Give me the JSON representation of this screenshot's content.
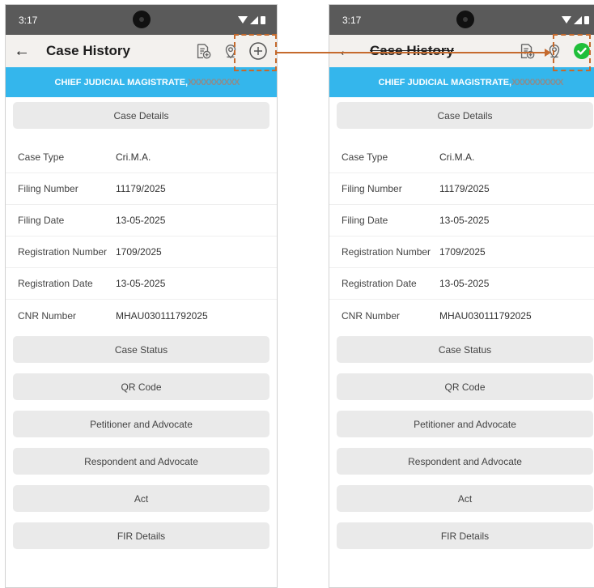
{
  "screens": [
    {
      "status": {
        "time": "3:17"
      },
      "header": {
        "back_icon": "arrow-left-icon",
        "title": "Case History",
        "action_icon": "add-circle-icon"
      },
      "court": {
        "name": "CHIEF JUDICIAL MAGISTRATE,",
        "redacted": "XXXXXXXXXX"
      },
      "case_details_label": "Case Details",
      "details": [
        {
          "label": "Case Type",
          "value": "Cri.M.A."
        },
        {
          "label": "Filing Number",
          "value": "11179/2025"
        },
        {
          "label": "Filing Date",
          "value": "13-05-2025"
        },
        {
          "label": "Registration Number",
          "value": "1709/2025"
        },
        {
          "label": "Registration Date",
          "value": "13-05-2025"
        },
        {
          "label": "CNR Number",
          "value": "MHAU030111792025"
        }
      ],
      "sections": [
        "Case Status",
        "QR Code",
        "Petitioner and Advocate",
        "Respondent and Advocate",
        "Act",
        "FIR Details"
      ]
    },
    {
      "status": {
        "time": "3:17"
      },
      "header": {
        "back_icon": "arrow-left-icon",
        "title": "Case History",
        "action_icon": "check-circle-icon"
      },
      "court": {
        "name": "CHIEF JUDICIAL MAGISTRATE,",
        "redacted": "XXXXXXXXXX"
      },
      "case_details_label": "Case Details",
      "details": [
        {
          "label": "Case Type",
          "value": "Cri.M.A."
        },
        {
          "label": "Filing Number",
          "value": "11179/2025"
        },
        {
          "label": "Filing Date",
          "value": "13-05-2025"
        },
        {
          "label": "Registration Number",
          "value": "1709/2025"
        },
        {
          "label": "Registration Date",
          "value": "13-05-2025"
        },
        {
          "label": "CNR Number",
          "value": "MHAU030111792025"
        }
      ],
      "sections": [
        "Case Status",
        "QR Code",
        "Petitioner and Advocate",
        "Respondent and Advocate",
        "Act",
        "FIR Details"
      ]
    }
  ],
  "colors": {
    "banner": "#34b6ec",
    "appbar": "#f3f1ee",
    "statusbar": "#5a5a5a",
    "annotation": "#c56a2d",
    "success": "#1fbf3a"
  }
}
